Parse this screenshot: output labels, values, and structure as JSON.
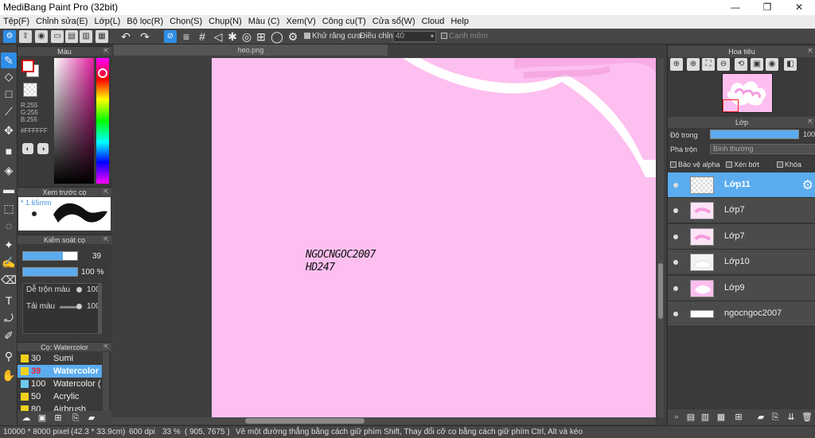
{
  "window": {
    "title": "MediBang Paint Pro (32bit)",
    "controls": [
      "—",
      "❐",
      "✕"
    ]
  },
  "menu": [
    "Tệp(F)",
    "Chỉnh sửa(E)",
    "Lớp(L)",
    "Bộ lọc(R)",
    "Chọn(S)",
    "Chụp(N)",
    "Màu (C)",
    "Xem(V)",
    "Công cụ(T)",
    "Cửa sổ(W)",
    "Cloud",
    "Help"
  ],
  "toolbar": {
    "antialias_label": "Khử răng cưa",
    "adjust_label": "Điều chỉnh",
    "adjust_value": "40",
    "smooth_label": "Cạnh mềm"
  },
  "color_panel": {
    "title": "Màu",
    "r": "R:255",
    "g": "G:255",
    "b": "B:255",
    "hex": "#FFFFFF",
    "hue_color": "#e0209c"
  },
  "brush_preview": {
    "title": "Xem trước cọ",
    "size": "1.65mm"
  },
  "brush_control": {
    "title": "Kiểm soát cọ",
    "size_value": "39",
    "size_level": 0.73,
    "opacity_value": "100 %",
    "opacity_level": 1.0,
    "blend_label": "Dễ trộn màu",
    "blend_value": "100",
    "load_label": "Tải màu",
    "load_value": "100"
  },
  "brush_list": {
    "title": "Cọ: Watercolor",
    "items": [
      {
        "num": "30",
        "name": "Sumi",
        "color": "#f0d01a"
      },
      {
        "num": "39",
        "name": "Watercolor",
        "color": "#f0d01a",
        "selected": true
      },
      {
        "num": "100",
        "name": "Watercolor (",
        "color": "#6fc8f0"
      },
      {
        "num": "50",
        "name": "Acrylic",
        "color": "#f0d01a"
      },
      {
        "num": "80",
        "name": "Airbrush",
        "color": "#f0d01a"
      }
    ]
  },
  "document": {
    "tab": "heo.png",
    "canvas_color": "#fdbfef",
    "text_line1": "NGOCNGOC2007",
    "text_line2": "HD247"
  },
  "navigator": {
    "title": "Hoa tiêu"
  },
  "layer_panel": {
    "title": "Lớp",
    "opacity_label": "Độ trong",
    "opacity_value": "100",
    "blend_label": "Pha trộn",
    "blend_value": "Bình thường",
    "protect_alpha": "Bảo vệ alpha",
    "clipping": "Xén bớt",
    "lock": "Khóa",
    "layers": [
      {
        "name": "Lớp11",
        "selected": true
      },
      {
        "name": "Lớp7"
      },
      {
        "name": "Lớp7"
      },
      {
        "name": "Lớp10"
      },
      {
        "name": "Lớp9"
      },
      {
        "name": "ngocngoc2007"
      }
    ]
  },
  "status": {
    "size": "10000 * 8000 pixel",
    "physical": "(42.3 * 33.9cm)",
    "dpi": "600 dpi",
    "zoom": "33 %",
    "coords": "( 905, 7675 )",
    "hint": "Vẽ một đường thẳng bằng cách giữ phím Shift, Thay đổi cỡ cọ bằng cách giữ phím Ctrl, Alt và kéo"
  }
}
